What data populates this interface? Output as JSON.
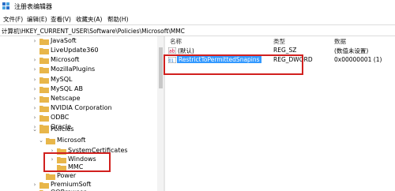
{
  "window": {
    "title": "注册表编辑器"
  },
  "menu": [
    "文件(F)",
    "编辑(E)",
    "查看(V)",
    "收藏夹(A)",
    "帮助(H)"
  ],
  "address": "计算机\\HKEY_CURRENT_USER\\Software\\Policies\\Microsoft\\MMC",
  "tree": [
    {
      "label": "JavaSoft",
      "expandable": true
    },
    {
      "label": "LiveUpdate360",
      "expandable": false
    },
    {
      "label": "Microsoft",
      "expandable": true
    },
    {
      "label": "MozillaPlugins",
      "expandable": true
    },
    {
      "label": "MySQL",
      "expandable": true
    },
    {
      "label": "MySQL AB",
      "expandable": true
    },
    {
      "label": "Netscape",
      "expandable": true
    },
    {
      "label": "NVIDIA Corporation",
      "expandable": true
    },
    {
      "label": "ODBC",
      "expandable": true
    },
    {
      "label": "Oracle",
      "expandable": true
    },
    {
      "label": "Policies",
      "expandable": true
    },
    {
      "label": "Microsoft",
      "expandable": true
    },
    {
      "label": "SystemCertificates",
      "expandable": true
    },
    {
      "label": "Windows",
      "expandable": true
    },
    {
      "label": "MMC",
      "expandable": false
    },
    {
      "label": "Power",
      "expandable": false
    },
    {
      "label": "PremiumSoft",
      "expandable": true
    },
    {
      "label": "QQBrowser",
      "expandable": true
    }
  ],
  "columns": {
    "name": "名称",
    "type": "类型",
    "data": "数据"
  },
  "values": [
    {
      "name": "(默认)",
      "type": "REG_SZ",
      "data": "(数值未设置)"
    },
    {
      "name": "RestrictToPermittedSnapins",
      "type": "REG_DWORD",
      "data": "0x00000001 (1)"
    }
  ],
  "colors": {
    "highlight": "#d1201e",
    "selection": "#3399ff",
    "folder": "#e8b64a"
  },
  "icons": {
    "app": "regedit-icon",
    "folder": "folder-icon",
    "value_string": "string-value-icon",
    "value_dword": "dword-value-icon"
  }
}
